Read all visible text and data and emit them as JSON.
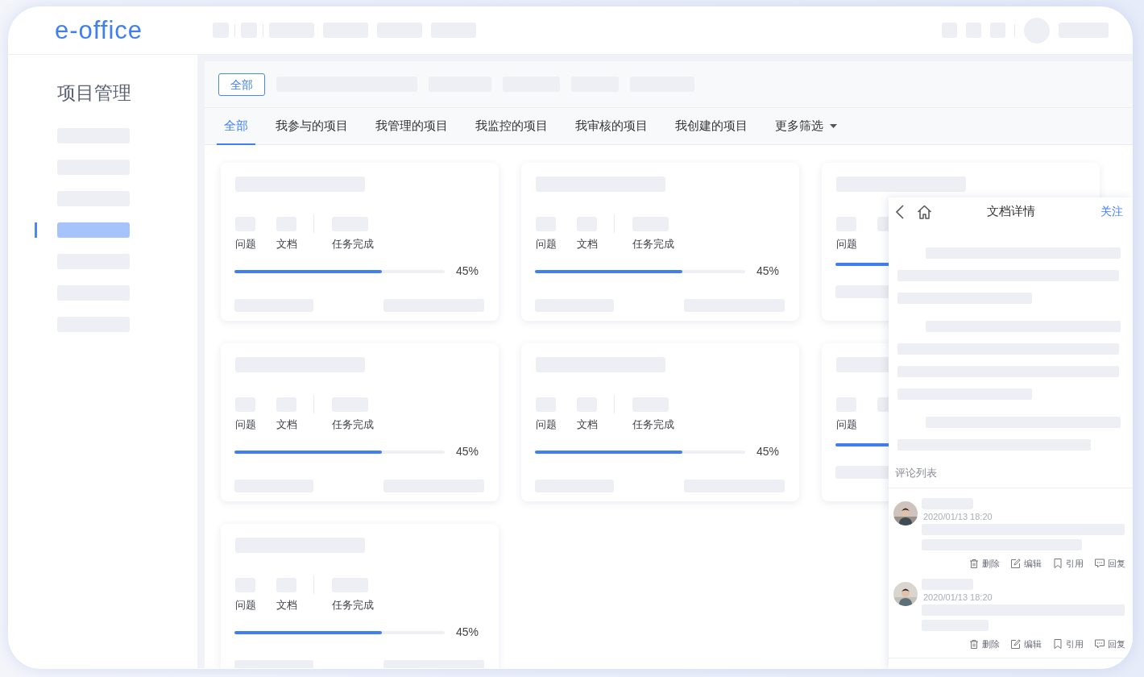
{
  "header": {
    "logo": "e-office"
  },
  "sidebar": {
    "title": "项目管理",
    "items": [
      {
        "selected": false
      },
      {
        "selected": false
      },
      {
        "selected": false
      },
      {
        "selected": true
      },
      {
        "selected": false
      },
      {
        "selected": false
      },
      {
        "selected": false
      }
    ]
  },
  "filter_bar": {
    "button": "全部"
  },
  "tabs": [
    {
      "label": "全部",
      "selected": true,
      "kind": "tab"
    },
    {
      "label": "我参与的项目",
      "selected": false,
      "kind": "tab"
    },
    {
      "label": "我管理的项目",
      "selected": false,
      "kind": "tab"
    },
    {
      "label": "我监控的项目",
      "selected": false,
      "kind": "tab"
    },
    {
      "label": "我审核的项目",
      "selected": false,
      "kind": "tab"
    },
    {
      "label": "我创建的项目",
      "selected": false,
      "kind": "tab"
    },
    {
      "label": "更多筛选",
      "selected": false,
      "kind": "dropdown"
    }
  ],
  "projects": [
    {
      "issues_label": "问题",
      "docs_label": "文档",
      "tasks_label": "任务完成",
      "level": 0.7,
      "percent": "45%"
    },
    {
      "issues_label": "问题",
      "docs_label": "文档",
      "tasks_label": "任务完成",
      "level": 0.7,
      "percent": "45%"
    },
    {
      "issues_label": "问题",
      "level": 0.7
    },
    {
      "issues_label": "问题",
      "docs_label": "文档",
      "tasks_label": "任务完成",
      "level": 0.7,
      "percent": "45%"
    },
    {
      "issues_label": "问题",
      "docs_label": "文档",
      "tasks_label": "任务完成",
      "level": 0.7,
      "percent": "45%"
    },
    {
      "issues_label": "问题",
      "level": 0.7
    },
    {
      "issues_label": "问题",
      "docs_label": "文档",
      "tasks_label": "任务完成",
      "level": 0.7,
      "percent": "45%"
    }
  ],
  "doc_panel": {
    "title": "文档详情",
    "follow": "关注",
    "comments_heading": "评论列表",
    "comments": [
      {
        "time": "2020/01/13 18:20",
        "actions": [
          {
            "kind": "delete",
            "label": "删除"
          },
          {
            "kind": "edit",
            "label": "编辑"
          },
          {
            "kind": "quote",
            "label": "引用"
          },
          {
            "kind": "reply",
            "label": "回复"
          }
        ]
      },
      {
        "time": "2020/01/13 18:20",
        "actions": [
          {
            "kind": "delete",
            "label": "删除"
          },
          {
            "kind": "edit",
            "label": "编辑"
          },
          {
            "kind": "quote",
            "label": "引用"
          },
          {
            "kind": "reply",
            "label": "回复"
          }
        ]
      }
    ]
  }
}
